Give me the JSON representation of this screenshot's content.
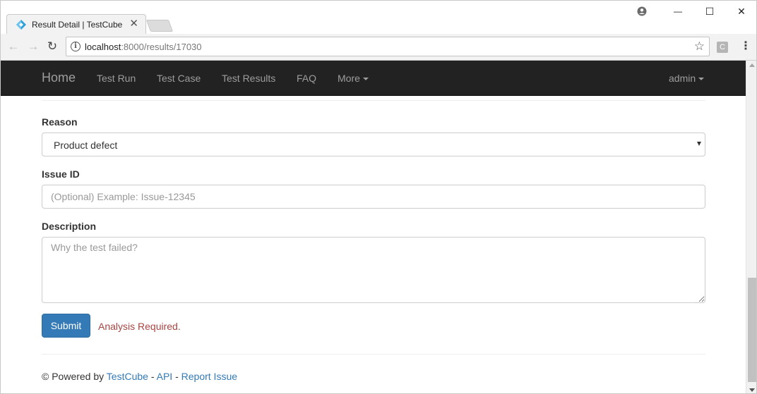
{
  "browser": {
    "tab_title": "Result Detail | TestCube",
    "tab_close": "✕",
    "url_host": "localhost",
    "url_path": ":8000/results/17030",
    "info_glyph": "i",
    "star_glyph": "☆",
    "ext_letter": "C",
    "menu_glyph": "⋮",
    "back_glyph": "←",
    "forward_glyph": "→",
    "reload_glyph": "↻",
    "window_minimize": "—",
    "window_maximize": "☐",
    "window_close": "✕",
    "profile_glyph": "●",
    "icons": {
      "favicon": "testcube-logo-icon",
      "back": "arrow-left-icon",
      "forward": "arrow-right-icon",
      "reload": "reload-icon",
      "info": "info-icon",
      "star": "star-icon",
      "extension": "extension-icon",
      "menu": "kebab-menu-icon"
    }
  },
  "navbar": {
    "brand": "Home",
    "links": [
      {
        "label": "Test Run"
      },
      {
        "label": "Test Case"
      },
      {
        "label": "Test Results"
      },
      {
        "label": "FAQ"
      },
      {
        "label": "More"
      }
    ],
    "user": "admin"
  },
  "form": {
    "reason_label": "Reason",
    "reason_value": "Product defect",
    "issue_label": "Issue ID",
    "issue_placeholder": "(Optional) Example: Issue-12345",
    "issue_value": "",
    "description_label": "Description",
    "description_placeholder": "Why the test failed?",
    "description_value": "",
    "submit_label": "Submit",
    "status_text": "Analysis Required."
  },
  "footer": {
    "prefix": "© Powered by ",
    "link_testcube": "TestCube",
    "sep1": " - ",
    "link_api": "API",
    "sep2": " - ",
    "link_report": "Report Issue"
  },
  "colors": {
    "navbar_bg": "#222222",
    "navbar_text": "#9d9d9d",
    "primary": "#337ab7",
    "danger_text": "#a94442",
    "link": "#337ab7"
  }
}
